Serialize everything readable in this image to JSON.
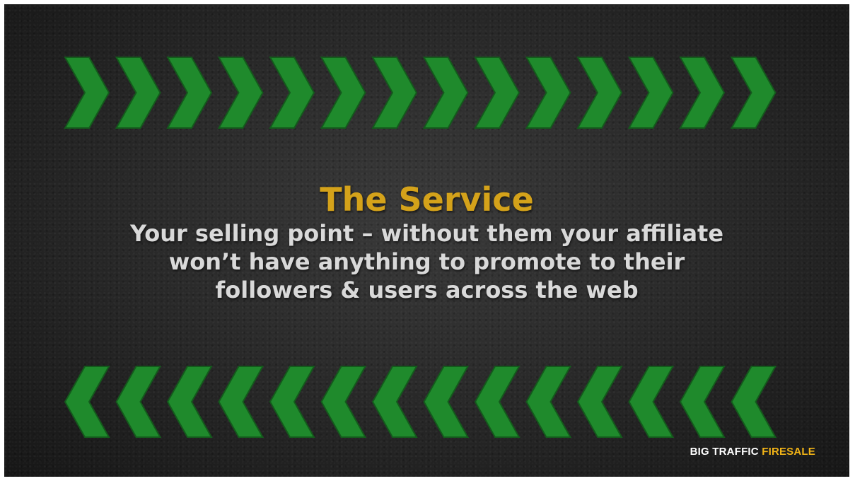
{
  "slide": {
    "title": "The Service",
    "body_lines": [
      "Your selling point – without them your affiliate",
      "won’t have anything to promote to their",
      "followers & users across the web"
    ]
  },
  "branding": {
    "part1": "BIG TRAFFIC",
    "part2": "FIRESALE"
  },
  "decoration": {
    "top_arrows": "chevron-right-icon",
    "bottom_arrows": "chevron-left-icon",
    "arrow_color": "#1f8a2c",
    "title_color": "#d4a21a",
    "brand_accent_color": "#f2b417"
  }
}
